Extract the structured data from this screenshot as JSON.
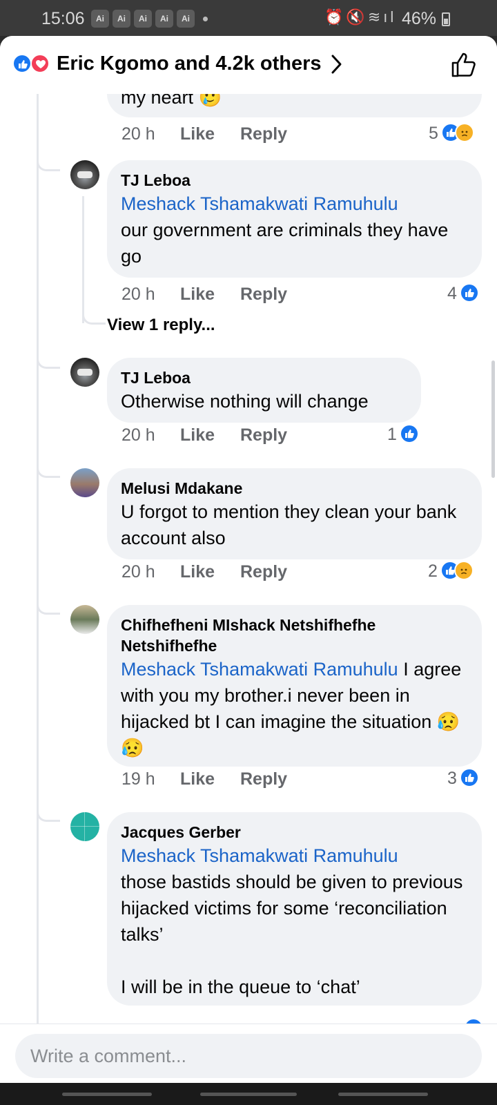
{
  "status": {
    "time": "15:06",
    "ai_badges": [
      "Ai",
      "Ai",
      "Ai",
      "Ai",
      "Ai"
    ],
    "icons": [
      "alarm-icon",
      "mute-icon",
      "wifi-icon",
      "signal-icon"
    ],
    "battery": "46%"
  },
  "header": {
    "title": "Eric Kgomo and 4.2k others"
  },
  "partial": {
    "text_tail": "my heart 🥲",
    "time": "20 h",
    "like": "Like",
    "reply": "Reply",
    "count": "5"
  },
  "comments": [
    {
      "author": "TJ Leboa",
      "mention": "Meshack Tshamakwati Ramuhulu",
      "text": "our government are criminals they have go",
      "time": "20 h",
      "like": "Like",
      "reply": "Reply",
      "count": "4"
    },
    {
      "author": "TJ Leboa",
      "mention": "",
      "text": "Otherwise nothing will change",
      "time": "20 h",
      "like": "Like",
      "reply": "Reply",
      "count": "1"
    },
    {
      "author": "Melusi Mdakane",
      "mention": "",
      "text": "U forgot to mention they clean your bank account also",
      "time": "20 h",
      "like": "Like",
      "reply": "Reply",
      "count": "2"
    },
    {
      "author": "Chifhefheni MIshack Netshifhefhe Netshifhefhe",
      "mention": "Meshack Tshamakwati Ramuhulu",
      "text": " I agree with you my brother.i never been in hijacked bt I can imagine the situation 😥😥",
      "time": "19 h",
      "like": "Like",
      "reply": "Reply",
      "count": "3"
    },
    {
      "author": "Jacques Gerber",
      "mention": "Meshack Tshamakwati Ramuhulu",
      "text": "those bastids should be given to previous hijacked victims for some ‘reconciliation talks’\n\nI will be in the queue to ‘chat’",
      "time": "",
      "like": "",
      "reply": "",
      "count": ""
    }
  ],
  "view_reply": "View 1 reply...",
  "composer": {
    "placeholder": "Write a comment..."
  },
  "colors": {
    "accent": "#1877f2",
    "mention": "#1b64c8",
    "bubble": "#f0f2f5",
    "love": "#f33e58",
    "sad": "#f7b125"
  }
}
